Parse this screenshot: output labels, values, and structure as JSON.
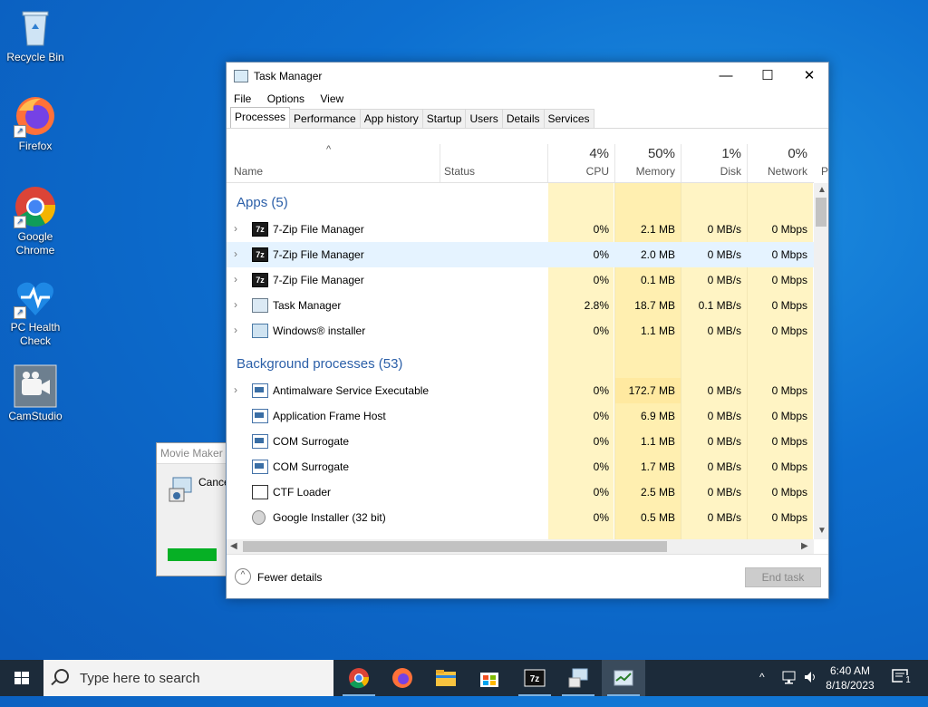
{
  "desktop": {
    "icons": [
      {
        "label": "Recycle Bin"
      },
      {
        "label": "Firefox"
      },
      {
        "label": "Google Chrome"
      },
      {
        "label": "PC Health Check"
      },
      {
        "label": "CamStudio"
      }
    ]
  },
  "moviemaker": {
    "title": "Movie Maker",
    "cancel": "Cance",
    "progress": 0.6
  },
  "taskmanager": {
    "title": "Task Manager",
    "menu": [
      "File",
      "Options",
      "View"
    ],
    "tabs": [
      "Processes",
      "Performance",
      "App history",
      "Startup",
      "Users",
      "Details",
      "Services"
    ],
    "active_tab": "Processes",
    "columns": {
      "name": "Name",
      "status": "Status",
      "cpu": {
        "pct": "4%",
        "label": "CPU"
      },
      "memory": {
        "pct": "50%",
        "label": "Memory"
      },
      "disk": {
        "pct": "1%",
        "label": "Disk"
      },
      "network": {
        "pct": "0%",
        "label": "Network"
      },
      "power": "P"
    },
    "groups": {
      "apps": "Apps (5)",
      "background": "Background processes (53)"
    },
    "apps": [
      {
        "name": "7-Zip File Manager",
        "cpu": "0%",
        "mem": "2.1 MB",
        "disk": "0 MB/s",
        "net": "0 Mbps",
        "icon": "7zip-icon"
      },
      {
        "name": "7-Zip File Manager",
        "cpu": "0%",
        "mem": "2.0 MB",
        "disk": "0 MB/s",
        "net": "0 Mbps",
        "icon": "7zip-icon"
      },
      {
        "name": "7-Zip File Manager",
        "cpu": "0%",
        "mem": "0.1 MB",
        "disk": "0 MB/s",
        "net": "0 Mbps",
        "icon": "7zip-icon"
      },
      {
        "name": "Task Manager",
        "cpu": "2.8%",
        "mem": "18.7 MB",
        "disk": "0.1 MB/s",
        "net": "0 Mbps",
        "icon": "task-manager-icon"
      },
      {
        "name": "Windows® installer",
        "cpu": "0%",
        "mem": "1.1 MB",
        "disk": "0 MB/s",
        "net": "0 Mbps",
        "icon": "installer-icon"
      }
    ],
    "background": [
      {
        "name": "Antimalware Service Executable",
        "cpu": "0%",
        "mem": "172.7 MB",
        "disk": "0 MB/s",
        "net": "0 Mbps",
        "expandable": true
      },
      {
        "name": "Application Frame Host",
        "cpu": "0%",
        "mem": "6.9 MB",
        "disk": "0 MB/s",
        "net": "0 Mbps"
      },
      {
        "name": "COM Surrogate",
        "cpu": "0%",
        "mem": "1.1 MB",
        "disk": "0 MB/s",
        "net": "0 Mbps"
      },
      {
        "name": "COM Surrogate",
        "cpu": "0%",
        "mem": "1.7 MB",
        "disk": "0 MB/s",
        "net": "0 Mbps"
      },
      {
        "name": "CTF Loader",
        "cpu": "0%",
        "mem": "2.5 MB",
        "disk": "0 MB/s",
        "net": "0 Mbps"
      },
      {
        "name": "Google Installer (32 bit)",
        "cpu": "0%",
        "mem": "0.5 MB",
        "disk": "0 MB/s",
        "net": "0 Mbps"
      }
    ],
    "fewer_details": "Fewer details",
    "end_task": "End task"
  },
  "taskbar": {
    "search_placeholder": "Type here to search",
    "time": "6:40 AM",
    "date": "8/18/2023",
    "notification_count": "1"
  },
  "colors": {
    "accent": "#2b5fa8",
    "heat": "#fff4c4",
    "heat_strong": "#ffe9a0"
  }
}
